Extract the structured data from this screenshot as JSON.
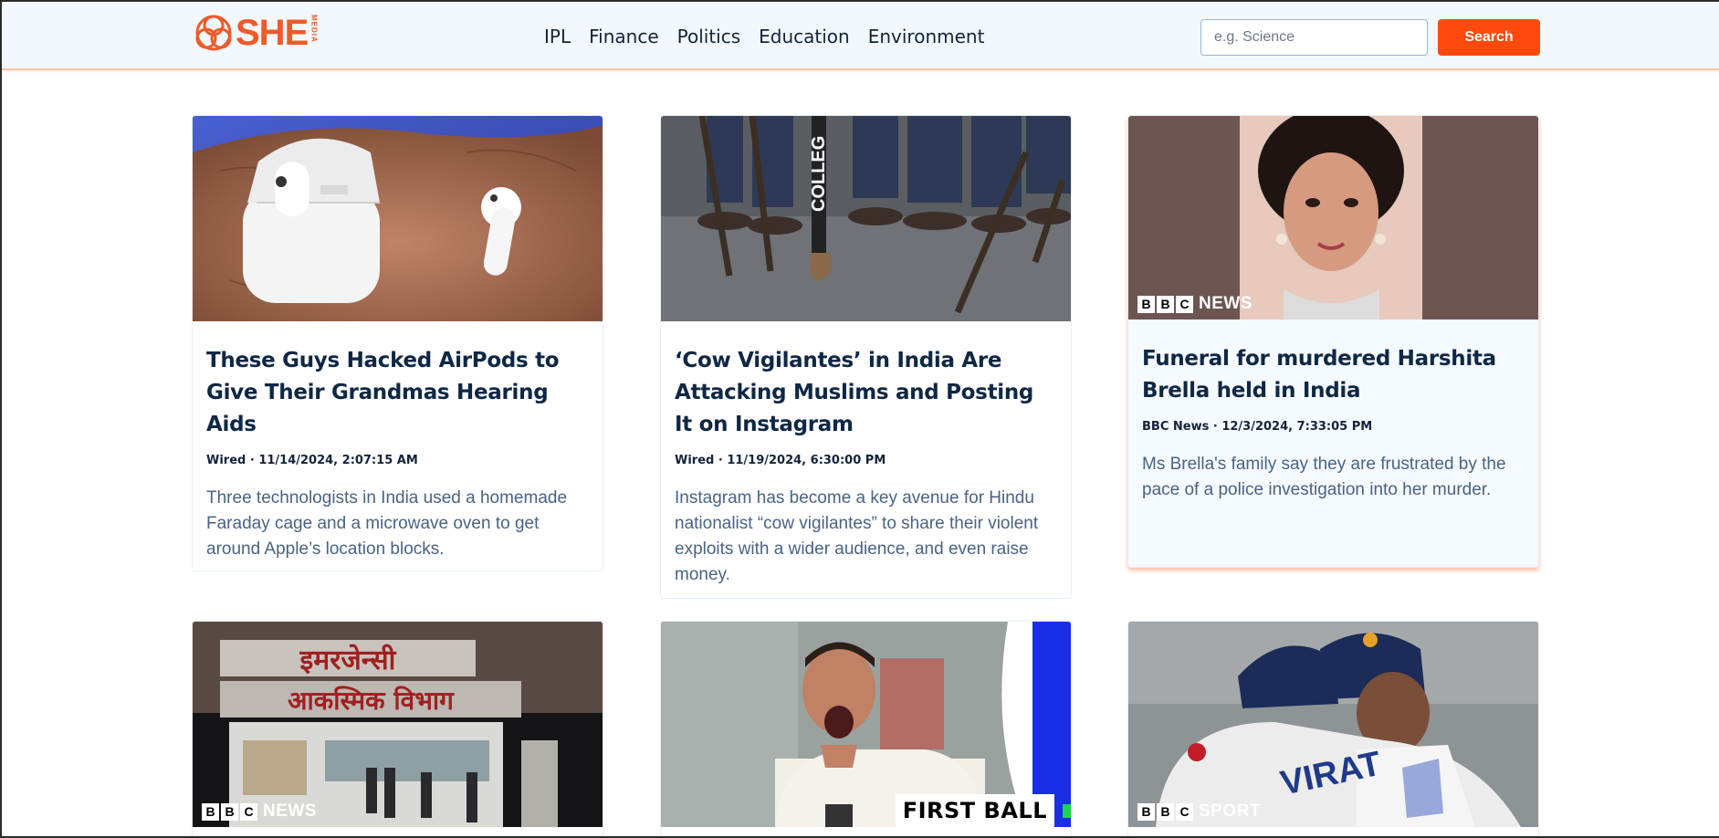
{
  "header": {
    "logo_text": "SHE",
    "logo_sub": "MEDIA",
    "nav": [
      "IPL",
      "Finance",
      "Politics",
      "Education",
      "Environment"
    ],
    "search": {
      "placeholder": "e.g. Science",
      "button_label": "Search"
    }
  },
  "colors": {
    "accent": "#ff4a0f",
    "logo": "#ef5a28",
    "title": "#0e2744",
    "desc": "#4a6383"
  },
  "articles": [
    {
      "title": "These Guys Hacked AirPods to Give Their Grandmas Hearing Aids",
      "meta": "Wired · 11/14/2024, 2:07:15 AM",
      "description": "Three technologists in India used a homemade Faraday cage and a microwave oven to get around Apple’s location blocks."
    },
    {
      "title": "‘Cow Vigilantes’ in India Are Attacking Muslims and Posting It on Instagram",
      "meta": "Wired · 11/19/2024, 6:30:00 PM",
      "description": "Instagram has become a key avenue for Hindu nationalist “cow vigilantes” to share their violent exploits with a wider audience, and even raise money.",
      "image_text": "COLLEG"
    },
    {
      "title": "Funeral for murdered Harshita Brella held in India",
      "meta": "BBC News · 12/3/2024, 7:33:05 PM",
      "description": "Ms Brella's family say they are frustrated by the pace of a police investigation into her murder.",
      "badge": [
        "B",
        "B",
        "C"
      ],
      "badge_word": "NEWS"
    },
    {
      "image_text": [
        "इमरजेन्सी",
        "आकस्मिक विभाग"
      ],
      "badge": [
        "B",
        "B",
        "C"
      ],
      "badge_word": "NEWS"
    },
    {
      "image_text": "FIRST BALL"
    },
    {
      "image_text": "VIRAT",
      "badge": [
        "B",
        "B",
        "C"
      ],
      "badge_word": "SPORT"
    }
  ]
}
